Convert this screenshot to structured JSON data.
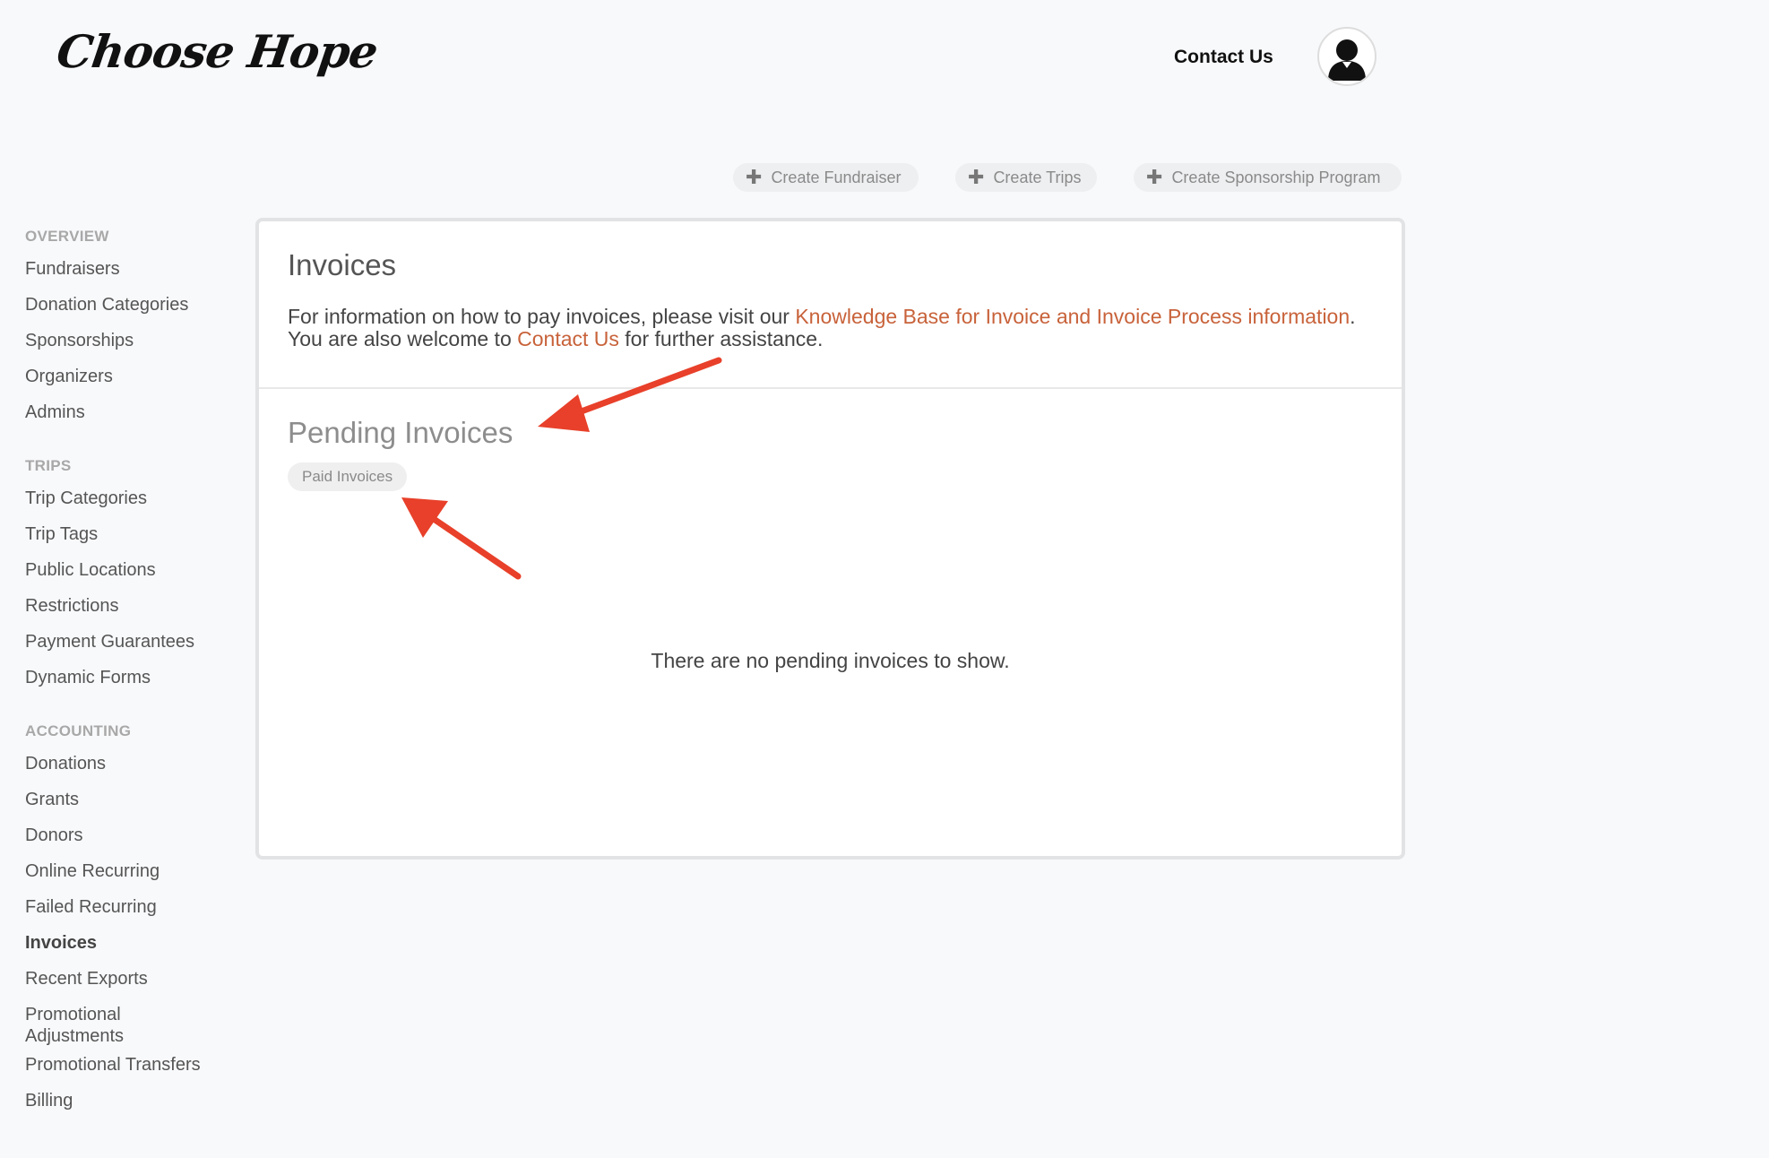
{
  "header": {
    "logo_text": "Choose Hope",
    "contact_label": "Contact Us"
  },
  "actions": [
    {
      "label": "Create Fundraiser"
    },
    {
      "label": "Create Trips"
    },
    {
      "label": "Create Sponsorship Program"
    }
  ],
  "sidebar": {
    "overview": {
      "heading": "OVERVIEW",
      "items": [
        "Fundraisers",
        "Donation Categories",
        "Sponsorships",
        "Organizers",
        "Admins"
      ]
    },
    "trips": {
      "heading": "TRIPS",
      "items": [
        "Trip Categories",
        "Trip Tags",
        "Public Locations",
        "Restrictions",
        "Payment Guarantees",
        "Dynamic Forms"
      ]
    },
    "accounting": {
      "heading": "ACCOUNTING",
      "items": [
        "Donations",
        "Grants",
        "Donors",
        "Online Recurring",
        "Failed Recurring",
        "Invoices",
        "Recent Exports",
        "Promotional Adjustments",
        "Promotional Transfers",
        "Billing"
      ],
      "active": "Invoices"
    }
  },
  "main": {
    "title": "Invoices",
    "info_prefix": "For information on how to pay invoices, please visit our ",
    "kb_link": "Knowledge Base for Invoice and Invoice Process information",
    "info_middle": ". You are also welcome to ",
    "contact_link": "Contact Us",
    "info_suffix": " for further assistance.",
    "pending_title": "Pending Invoices",
    "paid_button": "Paid Invoices",
    "empty_message": "There are no pending invoices to show."
  },
  "colors": {
    "accent_link": "#c8623a",
    "annotation_arrow": "#e8402a"
  },
  "icons": {
    "avatar": "user-silhouette-icon",
    "plus": "plus-icon"
  }
}
